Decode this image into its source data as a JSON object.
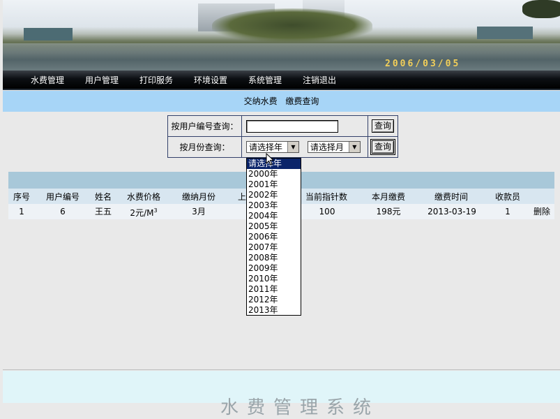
{
  "banner": {
    "date": "2006/03/05"
  },
  "nav": {
    "items": [
      "水费管理",
      "用户管理",
      "打印服务",
      "环境设置",
      "系统管理",
      "注销退出"
    ]
  },
  "subnav": {
    "pay": "交纳水费",
    "query": "缴费查询"
  },
  "query": {
    "by_user_label": "按用户编号查询：",
    "by_user_value": "",
    "by_month_label": "按月份查询：",
    "year_select": "请选择年",
    "month_select": "请选择月",
    "button": "查询"
  },
  "table": {
    "columns": [
      "序号",
      "用户编号",
      "姓名",
      "水费价格",
      "缴纳月份",
      "上",
      "当前指针数",
      "本月缴费",
      "缴费时间",
      "收款员"
    ],
    "rows": [
      {
        "no": "1",
        "user_id": "6",
        "name": "王五",
        "price": "2元/M",
        "price_sup": "3",
        "month": "3月",
        "current": "100",
        "fee": "198元",
        "time": "2013-03-19",
        "cashier": "1",
        "action": "删除"
      }
    ]
  },
  "year_dropdown": {
    "options": [
      "请选择年",
      "2000年",
      "2001年",
      "2002年",
      "2003年",
      "2004年",
      "2005年",
      "2006年",
      "2007年",
      "2008年",
      "2009年",
      "2010年",
      "2011年",
      "2012年",
      "2013年"
    ],
    "selected_index": 0
  },
  "footer": {
    "title": "水费管理系统"
  }
}
